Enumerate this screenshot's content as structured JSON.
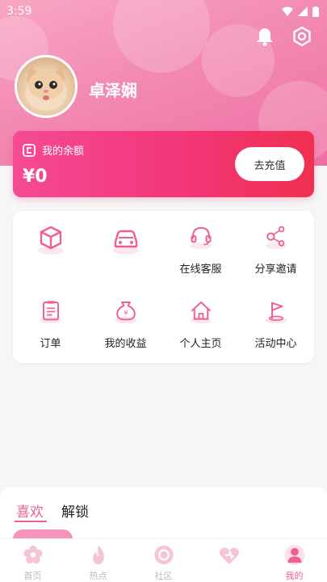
{
  "status": {
    "time": "3:59"
  },
  "profile": {
    "username": "卓泽娴"
  },
  "balance": {
    "title": "我的余额",
    "amount": "¥0",
    "recharge_label": "去充值"
  },
  "grid": {
    "items": [
      {
        "label": "",
        "icon": "cube-icon"
      },
      {
        "label": "",
        "icon": "car-icon"
      },
      {
        "label": "在线客服",
        "icon": "headset-icon"
      },
      {
        "label": "分享邀请",
        "icon": "share-icon"
      },
      {
        "label": "订单",
        "icon": "clipboard-icon"
      },
      {
        "label": "我的收益",
        "icon": "money-bag-icon"
      },
      {
        "label": "个人主页",
        "icon": "home-icon"
      },
      {
        "label": "活动中心",
        "icon": "flag-icon"
      }
    ]
  },
  "tabs": {
    "items": [
      "喜欢",
      "解锁"
    ],
    "active": "喜欢"
  },
  "nav": {
    "items": [
      {
        "label": "首页",
        "icon": "flower-icon"
      },
      {
        "label": "热点",
        "icon": "flame-icon"
      },
      {
        "label": "社区",
        "icon": "community-icon"
      },
      {
        "label": "",
        "icon": "heart-icon"
      },
      {
        "label": "我的",
        "icon": "user-icon"
      }
    ],
    "active_index": 4
  },
  "colors": {
    "accent": "#ef5f96",
    "card_start": "#f54a94",
    "card_end": "#f0304f"
  }
}
